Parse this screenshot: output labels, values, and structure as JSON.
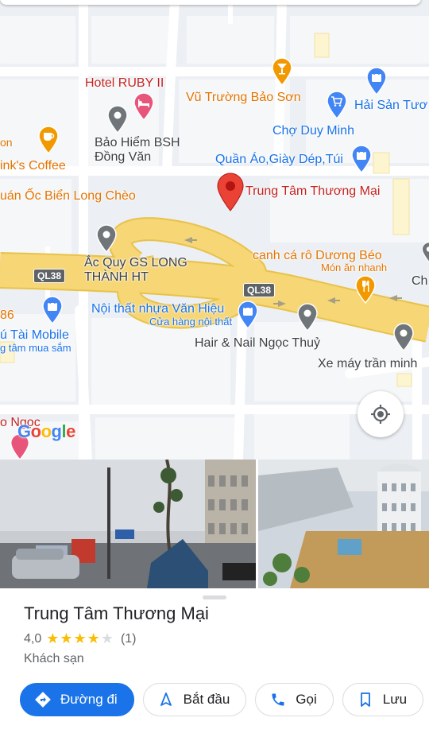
{
  "map": {
    "labels": {
      "hotel_ruby": "Hotel RUBY II",
      "vu_truong": "Vũ Trường Bảo Sơn",
      "hai_san": "Hải Sản Tươ",
      "cho_duy_minh": "Chợ Duy Minh",
      "bao_hiem": "Bảo Hiểm BSH Đồng Văn",
      "quan_ao": "Quần Áo,Giày Dép,Túi",
      "trung_tam": "Trung Tâm Thương Mại",
      "on": "on",
      "inks_coffee": "ink's Coffee",
      "oc_bien": "uán Ốc Biển Long Chèo",
      "ac_quy": "Ắc Quy GS LONG THÀNH HT",
      "canh_ca": "canh cá rô Dương Béo",
      "mon_an": "Món ăn nhanh",
      "ch": "Ch",
      "noi_that": "Nội thất nhựa Văn Hiệu",
      "cua_hang": "Cửa hàng nội thất",
      "num_86": "86",
      "tai_mobile": "ú Tài Mobile",
      "tam_mua_sam": "g tâm mua sắm",
      "hair_nail": "Hair & Nail Ngọc Thuỷ",
      "xe_may": "Xe máy trần minh",
      "o_ngoc": "o Ngọc"
    },
    "road_shields": [
      "QL38",
      "QL38"
    ],
    "google_logo": [
      "G",
      "o",
      "o",
      "g",
      "l",
      "e"
    ]
  },
  "place": {
    "title": "Trung Tâm Thương Mại",
    "rating": "4,0",
    "rating_value": 4,
    "rating_count": "(1)",
    "category": "Khách sạn"
  },
  "actions": {
    "directions": "Đường đi",
    "start": "Bắt đầu",
    "call": "Gọi",
    "save": "Lưu"
  },
  "colors": {
    "accent": "#1a73e8",
    "highway": "#f6d675",
    "pin_red": "#ea4335",
    "pin_grey": "#70757a",
    "shopping_blue": "#4285f4",
    "food_orange": "#f29900",
    "hotel_pink": "#e8557a"
  }
}
